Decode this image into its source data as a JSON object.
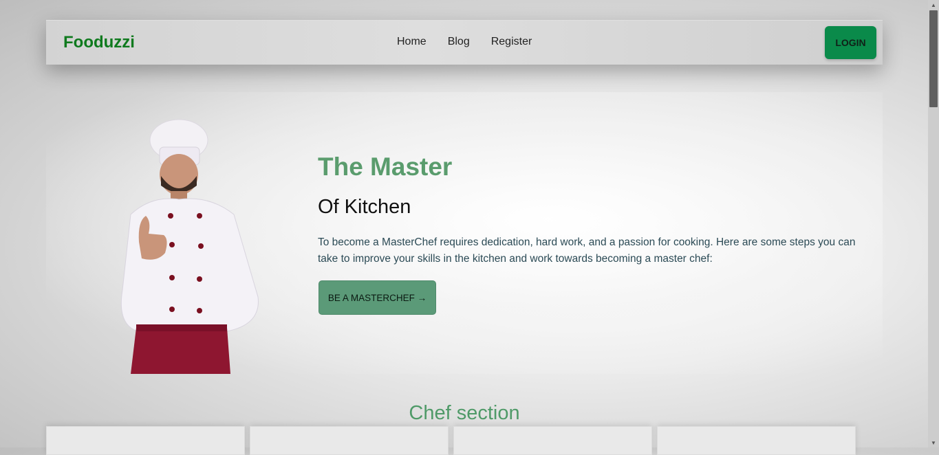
{
  "nav": {
    "brand": "Fooduzzi",
    "links": [
      "Home",
      "Blog",
      "Register"
    ],
    "login": "LOGIN"
  },
  "hero": {
    "title": "The Master",
    "subtitle": "Of Kitchen",
    "description": "To become a MasterChef requires dedication, hard work, and a passion for cooking. Here are some steps you can take to improve your skills in the kitchen and work towards becoming a master chef:",
    "cta": "BE A MASTERCHEF →"
  },
  "chef_section": {
    "title": "Chef section"
  },
  "colors": {
    "brand": "#0f7a1e",
    "accent": "#5b9a78",
    "login_bg": "#0a8a4a",
    "title_green": "#5a9c6d"
  }
}
